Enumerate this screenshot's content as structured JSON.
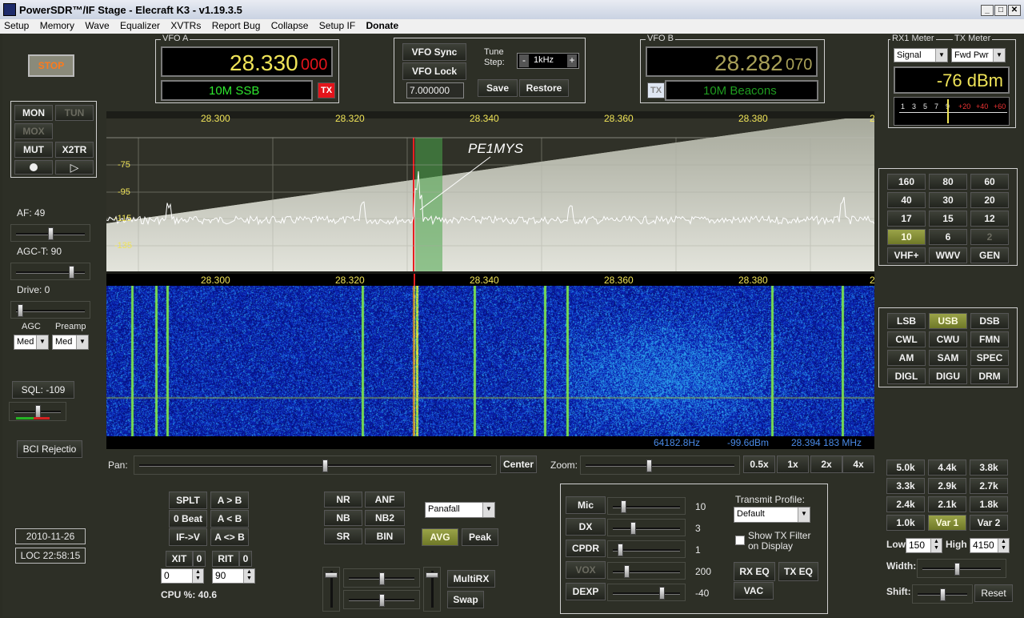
{
  "window": {
    "title": "PowerSDR™/IF Stage - Elecraft K3 - v1.19.3.5"
  },
  "menu": [
    "Setup",
    "Memory",
    "Wave",
    "Equalizer",
    "XVTRs",
    "Report Bug",
    "Collapse",
    "Setup IF",
    "Donate"
  ],
  "stop_button": "STOP",
  "vfo_a": {
    "group": "VFO A",
    "freq_main": "28.330",
    "freq_sub": "000",
    "band_mode": "10M SSB",
    "tx_label": "TX"
  },
  "vfo_b": {
    "group": "VFO B",
    "freq_main": "28.282",
    "freq_sub": "070",
    "band_mode": "10M Beacons",
    "tx_label": "TX"
  },
  "vfo_ctrl": {
    "sync": "VFO Sync",
    "lock": "VFO Lock",
    "tune_step_label": "Tune\nStep:",
    "tune_step": "1kHz",
    "minus": "-",
    "plus": "+",
    "freq_input": "7.000000",
    "save": "Save",
    "restore": "Restore"
  },
  "meter": {
    "rx_label": "RX1 Meter",
    "tx_label": "TX Meter",
    "rx_select": "Signal",
    "tx_select": "Fwd Pwr",
    "reading": "-76 dBm",
    "scale_white": [
      "1",
      "3",
      "5",
      "7",
      "9"
    ],
    "scale_red": [
      "+20",
      "+40",
      "+60"
    ]
  },
  "left": {
    "mon": "MON",
    "tun": "TUN",
    "mox": "MOX",
    "mut": "MUT",
    "x2tr": "X2TR",
    "af": "AF:  49",
    "agct": "AGC-T:  90",
    "drive": "Drive:  0",
    "agc_label": "AGC",
    "preamp_label": "Preamp",
    "agc_val": "Med",
    "preamp_val": "Med",
    "sql": "SQL:  -109",
    "bci": "BCI Rejectio",
    "date": "2010-11-26",
    "time": "LOC 22:58:15"
  },
  "display": {
    "freq_ticks": [
      "28.300",
      "28.320",
      "28.340",
      "28.360",
      "28.380",
      "2"
    ],
    "db_ticks": [
      "-75",
      "-95",
      "-115",
      "-135"
    ],
    "annotation": "PE1MYS",
    "status_hz": "64182.8Hz",
    "status_dbm": "-99.6dBm",
    "status_mhz": "28.394 183 MHz",
    "pan_label": "Pan:",
    "center": "Center",
    "zoom_label": "Zoom:",
    "zoom": [
      "0.5x",
      "1x",
      "2x",
      "4x"
    ]
  },
  "bands": [
    "160",
    "80",
    "60",
    "40",
    "30",
    "20",
    "17",
    "15",
    "12",
    "10",
    "6",
    "2",
    "VHF+",
    "WWV",
    "GEN"
  ],
  "modes": [
    "LSB",
    "USB",
    "DSB",
    "CWL",
    "CWU",
    "FMN",
    "AM",
    "SAM",
    "SPEC",
    "DIGL",
    "DIGU",
    "DRM"
  ],
  "filters": [
    "5.0k",
    "4.4k",
    "3.8k",
    "3.3k",
    "2.9k",
    "2.7k",
    "2.4k",
    "2.1k",
    "1.8k",
    "1.0k",
    "Var 1",
    "Var 2"
  ],
  "filter_ctrl": {
    "low_label": "Low",
    "low": "150",
    "high_label": "High",
    "high": "4150",
    "width": "Width:",
    "shift": "Shift:",
    "reset": "Reset"
  },
  "vfo_ops": {
    "splt": "SPLT",
    "atob": "A > B",
    "zerobeat": "0 Beat",
    "btoa": "A < B",
    "ifv": "IF->V",
    "swap": "A <> B",
    "xit": "XIT",
    "xit_v": "0",
    "rit": "RIT",
    "rit_v": "0",
    "xit_spin": "0",
    "rit_spin": "90",
    "cpu": "CPU %: 40.6"
  },
  "dsp": {
    "nr": "NR",
    "anf": "ANF",
    "nb": "NB",
    "nb2": "NB2",
    "sr": "SR",
    "bin": "BIN",
    "display_mode": "Panafall",
    "avg": "AVG",
    "peak": "Peak",
    "multirx": "MultiRX",
    "swap": "Swap"
  },
  "tx": {
    "mic": "Mic",
    "mic_v": "10",
    "dx": "DX",
    "dx_v": "3",
    "cpdr": "CPDR",
    "cpdr_v": "1",
    "vox": "VOX",
    "vox_v": "200",
    "dexp": "DEXP",
    "dexp_v": "-40",
    "profile_label": "Transmit Profile:",
    "profile": "Default",
    "show_filter": "Show TX Filter\non Display",
    "rxeq": "RX EQ",
    "txeq": "TX EQ",
    "vac": "VAC"
  },
  "colors": {
    "accent_yellow": "#f0e458",
    "vfo_green": "#2ee82e",
    "stop_orange": "#ff7a1a",
    "tx_red": "#e3141b"
  }
}
